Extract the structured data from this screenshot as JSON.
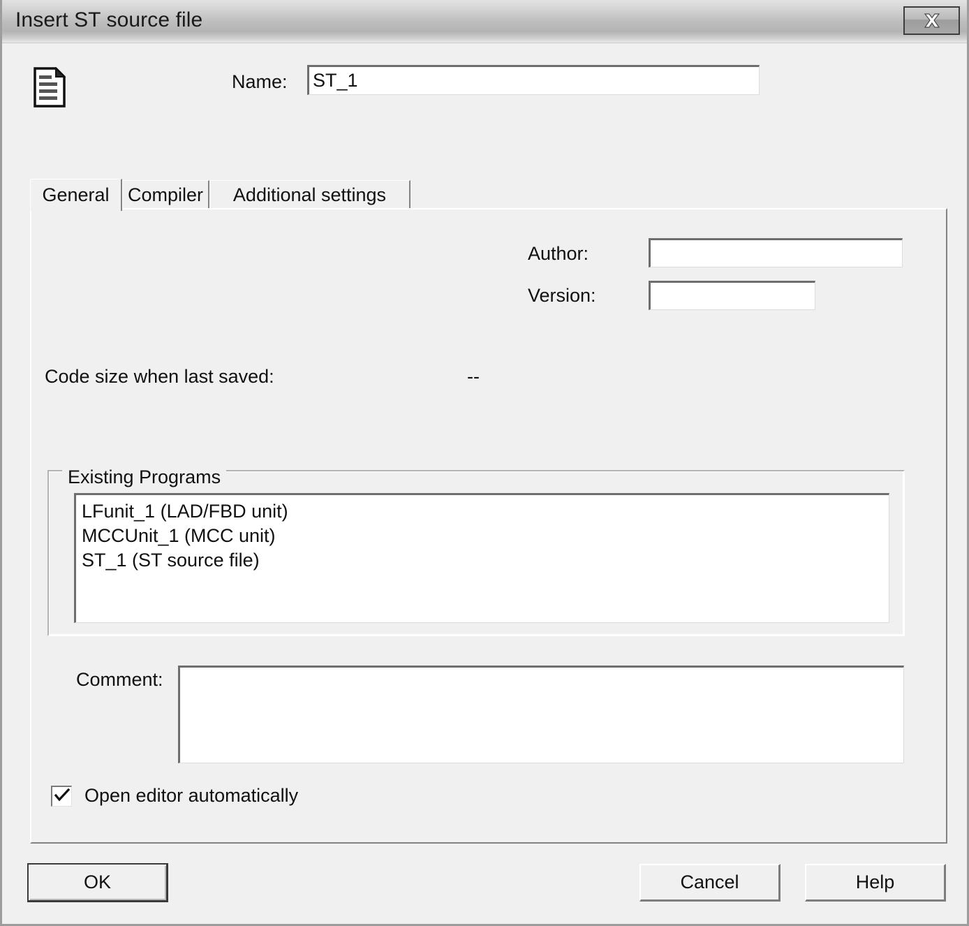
{
  "window": {
    "title": "Insert ST source file",
    "close_icon": "close-x-icon"
  },
  "header": {
    "icon": "st-source-file-document-icon",
    "name_label": "Name:",
    "name_value": "ST_1",
    "name_placeholder": ""
  },
  "tabs": [
    {
      "label": "General",
      "active": true
    },
    {
      "label": "Compiler",
      "active": false
    },
    {
      "label": "Additional settings",
      "active": false
    }
  ],
  "general": {
    "author_label": "Author:",
    "author_value": "",
    "author_placeholder": "",
    "version_label": "Version:",
    "version_value": "",
    "version_placeholder": "",
    "code_size_label": "Code size when last saved:",
    "code_size_value": "--",
    "existing_programs": {
      "legend": "Existing Programs",
      "items": [
        "LFunit_1 (LAD/FBD unit)",
        "MCCUnit_1 (MCC unit)",
        "ST_1 (ST source file)"
      ]
    },
    "comment_label": "Comment:",
    "comment_value": "",
    "comment_placeholder": "",
    "open_editor_label": "Open editor automatically",
    "open_editor_checked": true
  },
  "buttons": {
    "ok": "OK",
    "cancel": "Cancel",
    "help": "Help"
  },
  "colors": {
    "dialog_background": "#f0f0f0",
    "field_background": "#ffffff",
    "text": "#111111",
    "border_dark": "#6e6e6e",
    "border_light": "#ffffff"
  }
}
